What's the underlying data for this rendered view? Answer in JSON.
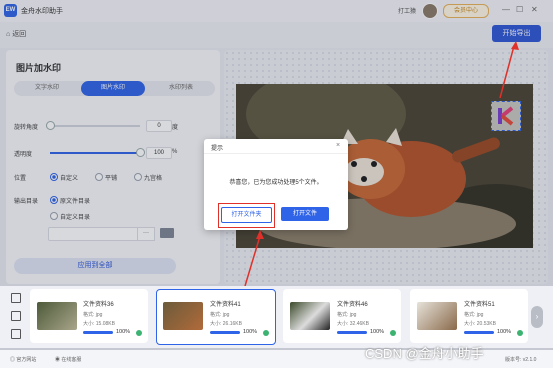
{
  "app": {
    "title": "金舟水印助手",
    "logo_text": "EW"
  },
  "header": {
    "user_name": "打工猿",
    "member_label": "会员中心",
    "win_controls": [
      "—",
      "☐",
      "✕"
    ]
  },
  "subbar": {
    "back_label": "返回",
    "export_label": "开始导出"
  },
  "panel": {
    "title": "图片加水印",
    "tabs": [
      "文字水印",
      "图片水印",
      "水印列表"
    ],
    "active_tab": 1,
    "rotation": {
      "label": "旋转角度",
      "value": "0",
      "unit": "度",
      "fraction": 0.0
    },
    "opacity": {
      "label": "透明度",
      "value": "100",
      "unit": "%",
      "fraction": 1.0
    },
    "position": {
      "label": "位置",
      "options": [
        "自定义",
        "平铺",
        "九宫格"
      ],
      "selected": 0
    },
    "output": {
      "label": "输出目录",
      "options": [
        "原文件目录",
        "自定义目录"
      ],
      "selected": 0,
      "path": "",
      "browse": "···"
    },
    "apply_label": "应用到全部"
  },
  "dialog": {
    "title": "提示",
    "close": "×",
    "message": "恭喜您，已为您成功处理5个文件。",
    "btn_open_folder": "打开文件夹",
    "btn_open_file": "打开文件"
  },
  "thumbnails": [
    {
      "name": "文件资料36",
      "format": "格式: jpg",
      "size": "大小: 15.08KB",
      "progress": "100%",
      "progress_value": 1.0
    },
    {
      "name": "文件资料41",
      "format": "格式: jpg",
      "size": "大小: 26.16KB",
      "progress": "100%",
      "progress_value": 1.0
    },
    {
      "name": "文件资料46",
      "format": "格式: jpg",
      "size": "大小: 32.46KB",
      "progress": "100%",
      "progress_value": 1.0
    },
    {
      "name": "文件资料51",
      "format": "格式: jpg",
      "size": "大小: 20.53KB",
      "progress": "100%",
      "progress_value": 1.0
    }
  ],
  "footer": {
    "left1": "官方网站",
    "left2": "在线客服",
    "version": "版本号: v2.1.0"
  },
  "watermark_overlay": "CSDN @金舟小助手",
  "colors": {
    "accent": "#2f63e8",
    "highlight": "#e0302a"
  }
}
